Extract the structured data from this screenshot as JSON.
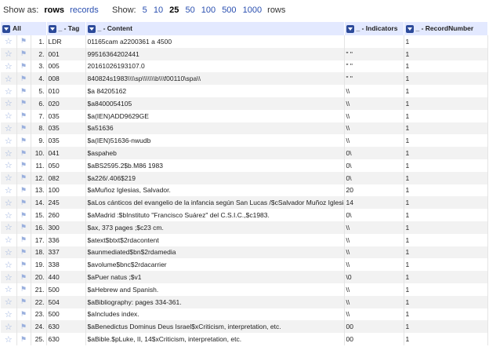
{
  "toolbar": {
    "show_as_label": "Show as:",
    "rows_label": "rows",
    "records_label": "records",
    "show_label": "Show:",
    "page_sizes": [
      "5",
      "10",
      "25",
      "50",
      "100",
      "500",
      "1000"
    ],
    "current_page_size": "25",
    "rows_suffix": "rows"
  },
  "columns": {
    "all": "All",
    "tag": "_ - Tag",
    "content": "_ - Content",
    "indicators": "_ - Indicators",
    "record": "_ - RecordNumber"
  },
  "rows": [
    {
      "idx": "1.",
      "tag": "LDR",
      "content": "01165cam a2200361 a 4500",
      "ind": "",
      "rec": "1"
    },
    {
      "idx": "2.",
      "tag": "001",
      "content": "99516364202441",
      "ind": "\" \"",
      "rec": "1"
    },
    {
      "idx": "3.",
      "tag": "005",
      "content": "20161026193107.0",
      "ind": "\" \"",
      "rec": "1"
    },
    {
      "idx": "4.",
      "tag": "008",
      "content": "840824s1983\\\\\\\\sp\\\\\\\\\\\\\\b\\\\\\f00110\\spa\\\\",
      "ind": "\" \"",
      "rec": "1"
    },
    {
      "idx": "5.",
      "tag": "010",
      "content": "$a   84205162",
      "ind": "\\\\",
      "rec": "1"
    },
    {
      "idx": "6.",
      "tag": "020",
      "content": "$a8400054105",
      "ind": "\\\\",
      "rec": "1"
    },
    {
      "idx": "7.",
      "tag": "035",
      "content": "$a(IEN)ADD9629GE",
      "ind": "\\\\",
      "rec": "1"
    },
    {
      "idx": "8.",
      "tag": "035",
      "content": "$a51636",
      "ind": "\\\\",
      "rec": "1"
    },
    {
      "idx": "9.",
      "tag": "035",
      "content": "$a(IEN)51636-nwudb",
      "ind": "\\\\",
      "rec": "1"
    },
    {
      "idx": "10.",
      "tag": "041",
      "content": "$aspaheb",
      "ind": "0\\",
      "rec": "1"
    },
    {
      "idx": "11.",
      "tag": "050",
      "content": "$aBS2595.2$b.M86 1983",
      "ind": "0\\",
      "rec": "1"
    },
    {
      "idx": "12.",
      "tag": "082",
      "content": "$a226/.406$219",
      "ind": "0\\",
      "rec": "1"
    },
    {
      "idx": "13.",
      "tag": "100",
      "content": "$aMuñoz Iglesias, Salvador.",
      "ind": "20",
      "rec": "1"
    },
    {
      "idx": "14.",
      "tag": "245",
      "content": "$aLos cánticos del evangelio de la infancia según San Lucas /$cSalvador Muñoz Iglesias.",
      "ind": "14",
      "rec": "1"
    },
    {
      "idx": "15.",
      "tag": "260",
      "content": "$aMadrid :$bInstituto \"Francisco Suárez\" del C.S.I.C.,$c1983.",
      "ind": "0\\",
      "rec": "1"
    },
    {
      "idx": "16.",
      "tag": "300",
      "content": "$ax, 373 pages ;$c23 cm.",
      "ind": "\\\\",
      "rec": "1"
    },
    {
      "idx": "17.",
      "tag": "336",
      "content": "$atext$btxt$2rdacontent",
      "ind": "\\\\",
      "rec": "1"
    },
    {
      "idx": "18.",
      "tag": "337",
      "content": "$aunmediated$bn$2rdamedia",
      "ind": "\\\\",
      "rec": "1"
    },
    {
      "idx": "19.",
      "tag": "338",
      "content": "$avolume$bnc$2rdacarrier",
      "ind": "\\\\",
      "rec": "1"
    },
    {
      "idx": "20.",
      "tag": "440",
      "content": "$aPuer natus ;$v1",
      "ind": "\\0",
      "rec": "1"
    },
    {
      "idx": "21.",
      "tag": "500",
      "content": "$aHebrew and Spanish.",
      "ind": "\\\\",
      "rec": "1"
    },
    {
      "idx": "22.",
      "tag": "504",
      "content": "$aBibliography: pages 334-361.",
      "ind": "\\\\",
      "rec": "1"
    },
    {
      "idx": "23.",
      "tag": "500",
      "content": "$aIncludes index.",
      "ind": "\\\\",
      "rec": "1"
    },
    {
      "idx": "24.",
      "tag": "630",
      "content": "$aBenedictus Dominus Deus Israel$xCriticism, interpretation, etc.",
      "ind": "00",
      "rec": "1"
    },
    {
      "idx": "25.",
      "tag": "630",
      "content": "$aBible.$pLuke, II, 14$xCriticism, interpretation, etc.",
      "ind": "00",
      "rec": "1"
    }
  ],
  "icons": {
    "star": "star-icon",
    "flag": "flag-icon",
    "dropdown": "chevron-down-icon"
  },
  "colors": {
    "header_bg": "#e3e9ff",
    "link": "#2a4fb0",
    "dropdown": "#2c4a9a",
    "even_row": "#f2f2f2"
  }
}
